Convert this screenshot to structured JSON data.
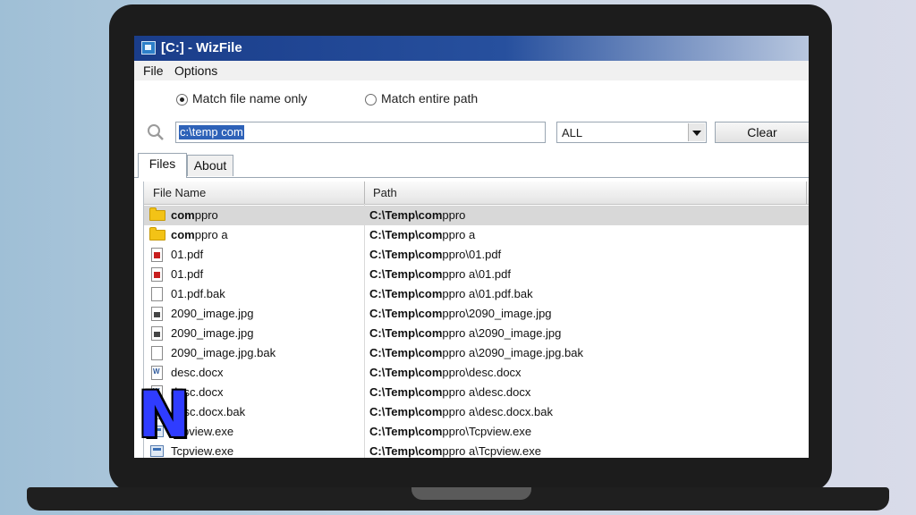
{
  "window": {
    "title": "[C:] - WizFile"
  },
  "menu": {
    "items": [
      {
        "label": "File"
      },
      {
        "label": "Options"
      }
    ]
  },
  "search": {
    "options": [
      {
        "label": "Match file name only",
        "checked": true
      },
      {
        "label": "Match entire path",
        "checked": false
      }
    ],
    "query": "c:\\temp com",
    "filter": "ALL",
    "clear_label": "Clear"
  },
  "tabs": [
    {
      "label": "Files",
      "active": true
    },
    {
      "label": "About",
      "active": false
    }
  ],
  "table": {
    "columns": [
      {
        "label": "File Name"
      },
      {
        "label": "Path"
      }
    ],
    "rows": [
      {
        "icon": "folder-icon",
        "match": "com",
        "rest": "ppro",
        "path_bold": "C:\\Temp\\com",
        "path_rest": "ppro",
        "selected": true
      },
      {
        "icon": "folder-icon",
        "match": "com",
        "rest": "ppro a",
        "path_bold": "C:\\Temp\\com",
        "path_rest": "ppro a",
        "selected": false
      },
      {
        "icon": "pdf-file-icon",
        "match": "",
        "rest": "01.pdf",
        "path_bold": "C:\\Temp\\com",
        "path_rest": "ppro\\01.pdf",
        "selected": false
      },
      {
        "icon": "pdf-file-icon",
        "match": "",
        "rest": "01.pdf",
        "path_bold": "C:\\Temp\\com",
        "path_rest": "ppro a\\01.pdf",
        "selected": false
      },
      {
        "icon": "blank-file-icon",
        "match": "",
        "rest": "01.pdf.bak",
        "path_bold": "C:\\Temp\\com",
        "path_rest": "ppro a\\01.pdf.bak",
        "selected": false
      },
      {
        "icon": "image-file-icon",
        "match": "",
        "rest": "2090_image.jpg",
        "path_bold": "C:\\Temp\\com",
        "path_rest": "ppro\\2090_image.jpg",
        "selected": false
      },
      {
        "icon": "image-file-icon",
        "match": "",
        "rest": "2090_image.jpg",
        "path_bold": "C:\\Temp\\com",
        "path_rest": "ppro a\\2090_image.jpg",
        "selected": false
      },
      {
        "icon": "blank-file-icon",
        "match": "",
        "rest": "2090_image.jpg.bak",
        "path_bold": "C:\\Temp\\com",
        "path_rest": "ppro a\\2090_image.jpg.bak",
        "selected": false
      },
      {
        "icon": "word-file-icon",
        "match": "",
        "rest": "desc.docx",
        "path_bold": "C:\\Temp\\com",
        "path_rest": "ppro\\desc.docx",
        "selected": false
      },
      {
        "icon": "word-file-icon",
        "match": "",
        "rest": "desc.docx",
        "path_bold": "C:\\Temp\\com",
        "path_rest": "ppro a\\desc.docx",
        "selected": false
      },
      {
        "icon": "blank-file-icon",
        "match": "",
        "rest": "desc.docx.bak",
        "path_bold": "C:\\Temp\\com",
        "path_rest": "ppro a\\desc.docx.bak",
        "selected": false
      },
      {
        "icon": "exe-file-icon",
        "match": "",
        "rest": "Tcpview.exe",
        "path_bold": "C:\\Temp\\com",
        "path_rest": "ppro\\Tcpview.exe",
        "selected": false
      },
      {
        "icon": "exe-file-icon",
        "match": "",
        "rest": "Tcpview.exe",
        "path_bold": "C:\\Temp\\com",
        "path_rest": "ppro a\\Tcpview.exe",
        "selected": false
      }
    ]
  },
  "watermark": {
    "letter": "N",
    "color": "#2f3cff"
  },
  "colors": {
    "titlebar": "#1a3d8a",
    "selection": "#2e62b8",
    "selected_row": "#d8d8d8",
    "folder": "#f3c316"
  }
}
